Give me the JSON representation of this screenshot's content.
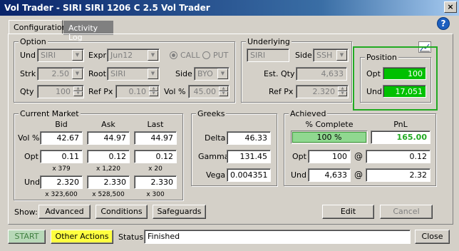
{
  "window": {
    "title": "Vol Trader - SIRI SIRI 1206 C 2.5 Vol Trader",
    "close_glyph": "×"
  },
  "tabs": [
    {
      "label": "Configuration"
    },
    {
      "label": "Activity Log"
    }
  ],
  "help_glyph": "?",
  "option": {
    "title": "Option",
    "und_label": "Und",
    "und_value": "SIRI",
    "expr_label": "Expr",
    "expr_value": "Jun12",
    "call_label": "CALL",
    "put_label": "PUT",
    "strk_label": "Strk",
    "strk_value": "2.50",
    "root_label": "Root",
    "root_value": "SIRI",
    "side_label": "Side",
    "side_value": "BYO",
    "qty_label": "Qty",
    "qty_value": "100",
    "refpx_label": "Ref Px",
    "refpx_value": "0.10",
    "volpct_label": "Vol %",
    "volpct_value": "45.00"
  },
  "underlying": {
    "title": "Underlying",
    "symbol_value": "SIRI",
    "side_label": "Side",
    "side_value": "SSH",
    "estqty_label": "Est. Qty",
    "estqty_value": "4,633",
    "refpx_label": "Ref Px",
    "refpx_value": "2.320"
  },
  "position": {
    "title": "Position",
    "opt_label": "Opt",
    "opt_value": "100",
    "und_label": "Und",
    "und_value": "17,051"
  },
  "market": {
    "title": "Current Market",
    "headers": [
      "Bid",
      "Ask",
      "Last"
    ],
    "volpct_label": "Vol %",
    "volpct": [
      "42.67",
      "44.97",
      "44.97"
    ],
    "opt_label": "Opt",
    "opt": [
      "0.11",
      "0.12",
      "0.12"
    ],
    "opt_sizes": [
      "x 379",
      "x 1,220",
      "x 20"
    ],
    "und_label": "Und",
    "und": [
      "2.320",
      "2.330",
      "2.330"
    ],
    "und_sizes": [
      "x 323,600",
      "x 528,500",
      "x 300"
    ]
  },
  "greeks": {
    "title": "Greeks",
    "delta_label": "Delta",
    "delta": "46.33",
    "gamma_label": "Gamma",
    "gamma": "131.45",
    "vega_label": "Vega",
    "vega": "0.004351"
  },
  "achieved": {
    "title": "Achieved",
    "complete_header": "% Complete",
    "pnl_header": "PnL",
    "complete_value": "100 %",
    "complete_fraction": 1.0,
    "pnl_value": "165.00",
    "opt_label": "Opt",
    "opt_qty": "100",
    "opt_at": "@",
    "opt_px": "0.12",
    "und_label": "Und",
    "und_qty": "4,633",
    "und_at": "@",
    "und_px": "2.32"
  },
  "show": {
    "label": "Show:",
    "advanced": "Advanced",
    "conditions": "Conditions",
    "safeguards": "Safeguards"
  },
  "edit_label": "Edit",
  "cancel_label": "Cancel",
  "bottom": {
    "start": "START",
    "other_actions": "Other Actions",
    "status_label": "Status",
    "status_value": "Finished",
    "close": "Close"
  },
  "colors": {
    "position_highlight": "#22aa22",
    "position_fill": "#00c000",
    "pnl_text": "#22aa22",
    "other_actions_bg": "#ffff40"
  }
}
